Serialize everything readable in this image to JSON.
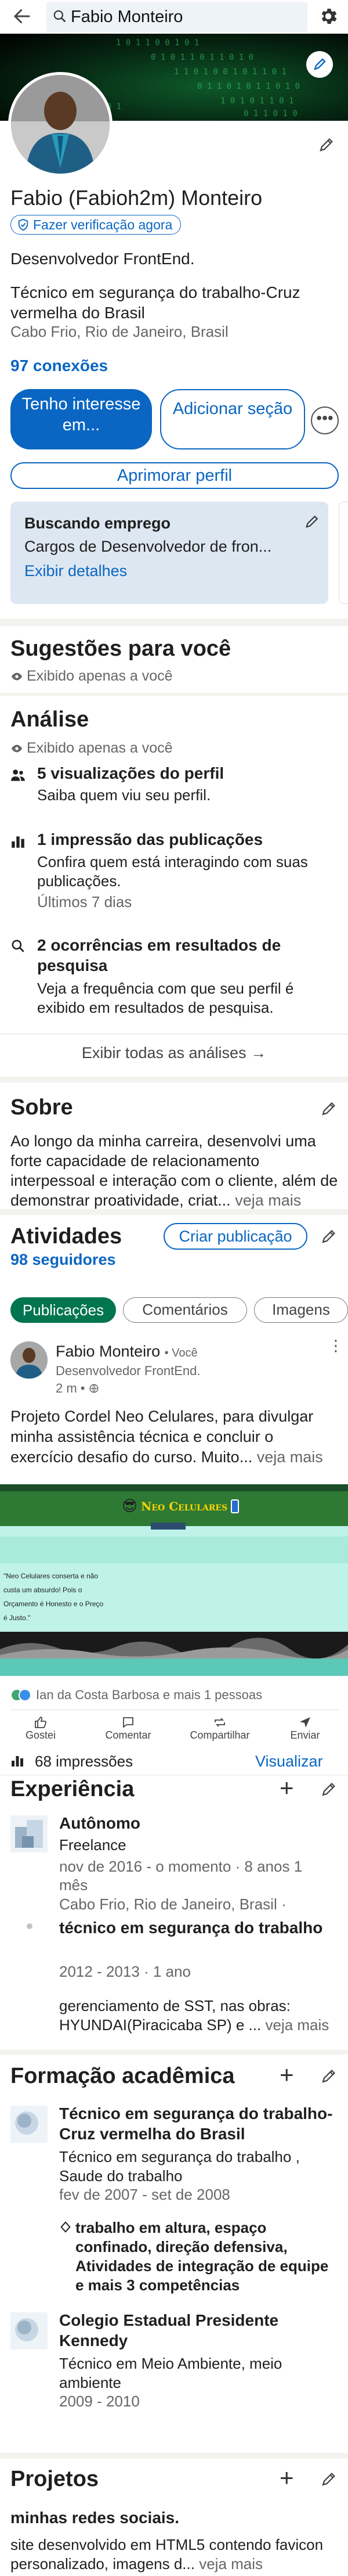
{
  "topbar": {
    "search_value": "Fabio Monteiro"
  },
  "profile": {
    "name": "Fabio (Fabioh2m) Monteiro",
    "verify_label": "Fazer verificação agora",
    "headline": "Desenvolvedor FrontEnd.",
    "subheadline": "Técnico em segurança do trabalho-Cruz vermelha do Brasil",
    "location": "Cabo Frio, Rio de Janeiro, Brasil",
    "connections": "97 conexões",
    "btn_open_to": "Tenho interesse em...",
    "btn_add_section": "Adicionar seção",
    "btn_enhance": "Aprimorar perfil",
    "open_to_title": "Buscando emprego",
    "open_to_text": "Cargos de Desenvolvedor de fron...",
    "open_to_link": "Exibir detalhes"
  },
  "suggestions": {
    "title": "Sugestões para você",
    "visibility": "Exibido apenas a você"
  },
  "analytics": {
    "title": "Análise",
    "visibility": "Exibido apenas a você",
    "items": [
      {
        "title": "5 visualizações do perfil",
        "desc": "Saiba quem viu seu perfil.",
        "extra": ""
      },
      {
        "title": "1 impressão das publicações",
        "desc": "Confira quem está interagindo com suas publicações.",
        "extra": "Últimos 7 dias"
      },
      {
        "title": "2 ocorrências em resultados de pesquisa",
        "desc": "Veja a frequência com que seu perfil é exibido em resultados de pesquisa.",
        "extra": ""
      }
    ],
    "show_all": "Exibir todas as análises →"
  },
  "about": {
    "title": "Sobre",
    "text": "Ao longo da minha carreira, desenvolvi uma forte capacidade de relacionamento interpessoal e interação com o cliente, além de demonstrar proatividade, criat...",
    "more": "veja mais"
  },
  "activity": {
    "title": "Atividades",
    "followers": "98 seguidores",
    "create_post": "Criar publicação",
    "tabs": [
      "Publicações",
      "Comentários",
      "Imagens"
    ],
    "post": {
      "author": "Fabio Monteiro",
      "degree": "• Você",
      "headline": "Desenvolvedor FrontEnd.",
      "time": "2 m •",
      "text": "Projeto Cordel Neo Celulares, para  divulgar minha assistência técnica e concluir o exercício desafio do curso. Muito...",
      "more": "veja mais",
      "banner_brand": "Neo Celulares",
      "banner_quote": "\"Neo Celulares conserta e não custa um absurdo! Pois o Orçamento é Honesto e o Preço é Justo.\"",
      "reactions": "Ian da Costa Barbosa e mais 1 pessoas",
      "actions": [
        "Gostei",
        "Comentar",
        "Compartilhar",
        "Enviar"
      ],
      "impressions": "68 impressões",
      "view": "Visualizar"
    }
  },
  "experience": {
    "title": "Experiência",
    "items": [
      {
        "title": "Autônomo",
        "company": "Freelance",
        "dates": "nov de 2016 - o momento · 8 anos 1 mês",
        "location": "Cabo Frio, Rio de Janeiro, Brasil ·"
      },
      {
        "title": "técnico em segurança do trabalho",
        "dates": "2012 - 2013 · 1 ano",
        "desc": "gerenciamento de SST, nas obras: HYUNDAI(Piracicaba SP) e ...",
        "more": "veja mais"
      }
    ]
  },
  "education": {
    "title": "Formação acadêmica",
    "items": [
      {
        "school": "Técnico em segurança do trabalho-Cruz vermelha do Brasil",
        "degree": "Técnico em segurança do trabalho , Saude do trabalho",
        "dates": "fev de 2007 - set de 2008",
        "skills": "trabalho em altura, espaço confinado, direção defensiva, Atividades de integração de equipe e mais 3 competências"
      },
      {
        "school": "Colegio Estadual Presidente Kennedy",
        "degree": "Técnico em Meio Ambiente, meio ambiente",
        "dates": "2009 - 2010"
      }
    ]
  },
  "projects": {
    "title": "Projetos",
    "item_title": "minhas redes sociais.",
    "item_desc": "site desenvolvido em HTML5 contendo favicon personalizado, imagens d...",
    "more": "veja mais"
  },
  "colors": {
    "accent": "#0a66c2",
    "green": "#01754f",
    "bg": "#f4f2ee"
  }
}
